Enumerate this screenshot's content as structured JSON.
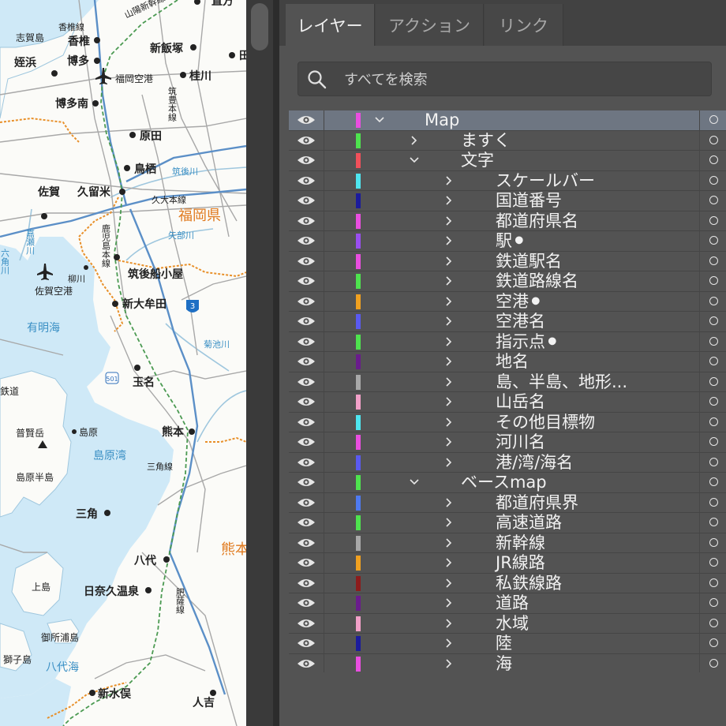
{
  "map": {
    "labels": {
      "shikanoshima": "志賀島",
      "kashiisen": "香椎線",
      "sanyo_shinkansen": "山陽新幹線",
      "nogata": "直方",
      "kashii": "香椎",
      "shiniizuka": "新飯塚",
      "meinohama": "姪浜",
      "hakata": "博多",
      "fukuoka_airport": "福岡空港",
      "keisen": "桂川",
      "chikuho_line": "筑豊本線",
      "hakata_minami": "博多南",
      "haruda": "原田",
      "tosu": "鳥栖",
      "chikugogawa": "筑後川",
      "saga": "佐賀",
      "kurume": "久留米",
      "kyudai_line": "久大本線",
      "fukuoka_pref": "福岡県",
      "kagoshima_line": "鹿児島本線",
      "yabegawa": "矢部川",
      "kasegawa": "嘉瀬川",
      "rokkakugawa": "六角川",
      "chikugo_funagoya": "筑後船小屋",
      "yanagawa": "柳川",
      "saga_airport": "佐賀空港",
      "shin_omuta": "新大牟田",
      "route3": "3",
      "ariake_sea": "有明海",
      "kikuchigawa": "菊池川",
      "route501": "501",
      "tamana": "玉名",
      "railway_fragment": "鉄道",
      "fugendake": "普賢岳",
      "shimabara": "島原",
      "kumamoto": "熊本",
      "shimabara_bay": "島原湾",
      "misumi_line": "三角線",
      "shimabara_peninsula": "島原半島",
      "misumi": "三角",
      "kuma_fragment": "熊本",
      "yatsushiro": "八代",
      "kamishima": "上島",
      "hinagu_onsen": "日奈久温泉",
      "hisatsu_line": "肥薩線",
      "goshonoura": "御所浦島",
      "shishijima": "獅子島",
      "yatsushiro_sea": "八代海",
      "shin_minamata": "新水俣",
      "hitoyoshi": "人吉",
      "ta_fragment": "田"
    }
  },
  "panel": {
    "tabs": [
      {
        "label": "レイヤー",
        "active": true
      },
      {
        "label": "アクション",
        "active": false
      },
      {
        "label": "リンク",
        "active": false
      }
    ],
    "search": {
      "placeholder": "すべてを検索",
      "value": ""
    },
    "layers": [
      {
        "name": "Map",
        "color": "#e94ee0",
        "depth": 0,
        "expanded": true,
        "selected": true
      },
      {
        "name": "ますく",
        "color": "#4ee34e",
        "depth": 1,
        "expanded": false,
        "selected": false
      },
      {
        "name": "文字",
        "color": "#f0505a",
        "depth": 1,
        "expanded": true,
        "selected": false
      },
      {
        "name": "スケールバー",
        "color": "#4ee6f0",
        "depth": 2,
        "expanded": false,
        "selected": false
      },
      {
        "name": "国道番号",
        "color": "#1c1c9c",
        "depth": 2,
        "expanded": false,
        "selected": false
      },
      {
        "name": "都道府県名",
        "color": "#e94ee0",
        "depth": 2,
        "expanded": false,
        "selected": false
      },
      {
        "name": "駅⚫",
        "color": "#9a4ef0",
        "depth": 2,
        "expanded": false,
        "selected": false
      },
      {
        "name": "鉄道駅名",
        "color": "#e94ee0",
        "depth": 2,
        "expanded": false,
        "selected": false
      },
      {
        "name": "鉄道路線名",
        "color": "#4ee34e",
        "depth": 2,
        "expanded": false,
        "selected": false
      },
      {
        "name": "空港⚫",
        "color": "#f0a020",
        "depth": 2,
        "expanded": false,
        "selected": false
      },
      {
        "name": "空港名",
        "color": "#5a5af0",
        "depth": 2,
        "expanded": false,
        "selected": false
      },
      {
        "name": "指示点⚫",
        "color": "#4ee34e",
        "depth": 2,
        "expanded": false,
        "selected": false
      },
      {
        "name": "地名",
        "color": "#6a1c8c",
        "depth": 2,
        "expanded": false,
        "selected": false
      },
      {
        "name": "島、半島、地形...",
        "color": "#a8a8a8",
        "depth": 2,
        "expanded": false,
        "selected": false
      },
      {
        "name": "山岳名",
        "color": "#f2a0c8",
        "depth": 2,
        "expanded": false,
        "selected": false
      },
      {
        "name": "その他目標物",
        "color": "#4ee6f0",
        "depth": 2,
        "expanded": false,
        "selected": false
      },
      {
        "name": "河川名",
        "color": "#e94ee0",
        "depth": 2,
        "expanded": false,
        "selected": false
      },
      {
        "name": "港/湾/海名",
        "color": "#5a5af0",
        "depth": 2,
        "expanded": false,
        "selected": false
      },
      {
        "name": "ベースmap",
        "color": "#4ee34e",
        "depth": 1,
        "expanded": true,
        "selected": false
      },
      {
        "name": "都道府県界",
        "color": "#4e7af0",
        "depth": 2,
        "expanded": false,
        "selected": false
      },
      {
        "name": "高速道路",
        "color": "#4ee34e",
        "depth": 2,
        "expanded": false,
        "selected": false
      },
      {
        "name": "新幹線",
        "color": "#a8a8a8",
        "depth": 2,
        "expanded": false,
        "selected": false
      },
      {
        "name": "JR線路",
        "color": "#f0a020",
        "depth": 2,
        "expanded": false,
        "selected": false
      },
      {
        "name": "私鉄線路",
        "color": "#8c1c1c",
        "depth": 2,
        "expanded": false,
        "selected": false
      },
      {
        "name": "道路",
        "color": "#6a1c8c",
        "depth": 2,
        "expanded": false,
        "selected": false
      },
      {
        "name": "水域",
        "color": "#f2a0c8",
        "depth": 2,
        "expanded": false,
        "selected": false
      },
      {
        "name": "陸",
        "color": "#1c1c9c",
        "depth": 2,
        "expanded": false,
        "selected": false
      },
      {
        "name": "海",
        "color": "#e94ee0",
        "depth": 2,
        "expanded": false,
        "selected": false
      }
    ]
  }
}
